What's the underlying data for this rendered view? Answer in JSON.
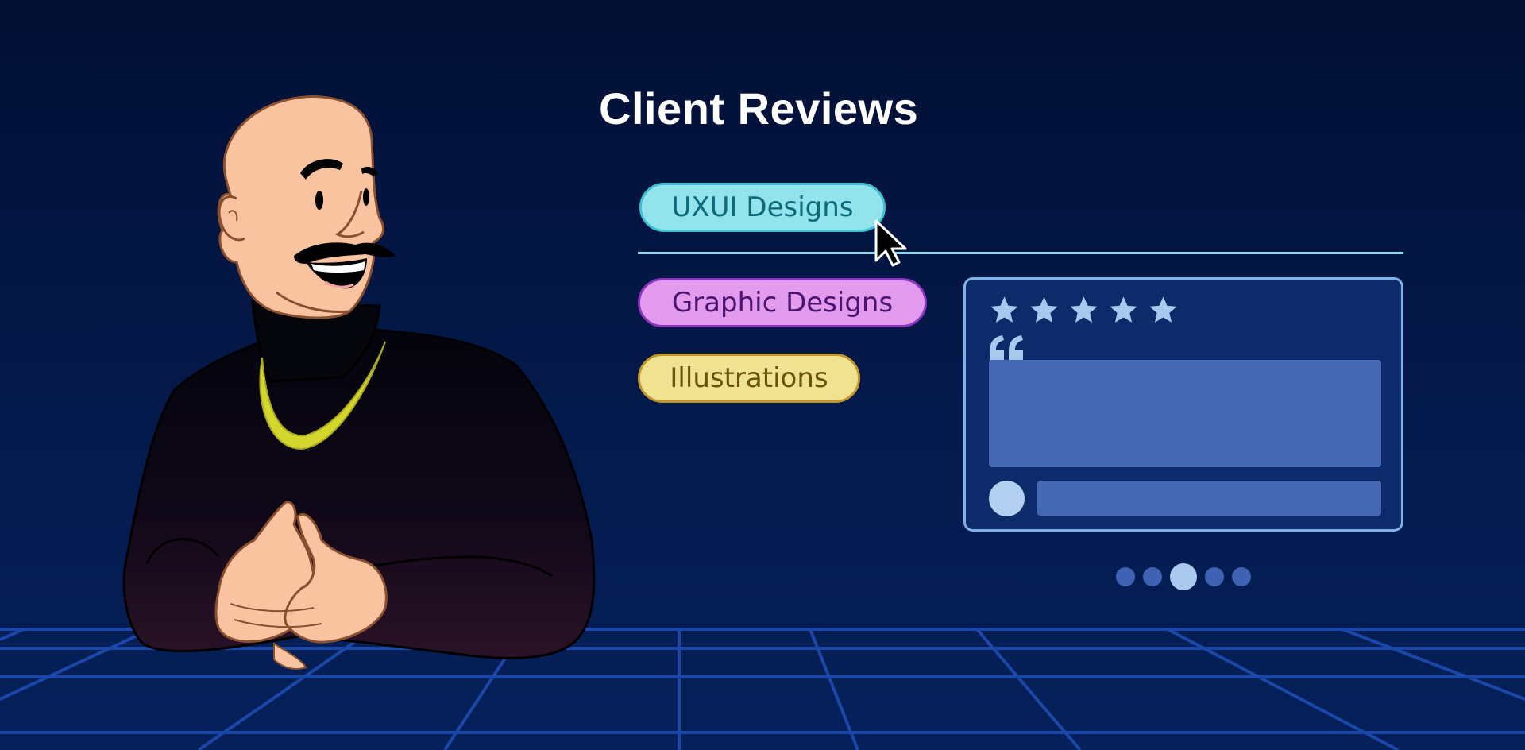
{
  "section": {
    "title": "Client Reviews"
  },
  "tabs": [
    {
      "label": "UXUI Designs",
      "active": true,
      "color": "#92e3ec"
    },
    {
      "label": "Graphic Designs",
      "active": false,
      "color": "#e39bee"
    },
    {
      "label": "Illustrations",
      "active": false,
      "color": "#efe291"
    }
  ],
  "review_card": {
    "rating": 5,
    "rating_max": 5,
    "icons": [
      "star-icon",
      "quote-icon"
    ]
  },
  "carousel": {
    "total": 5,
    "current": 3
  },
  "colors": {
    "background": "#041a4c",
    "accent": "#8ed8ee",
    "card": "#0d2b6b",
    "card_border": "#7fb2e6"
  }
}
